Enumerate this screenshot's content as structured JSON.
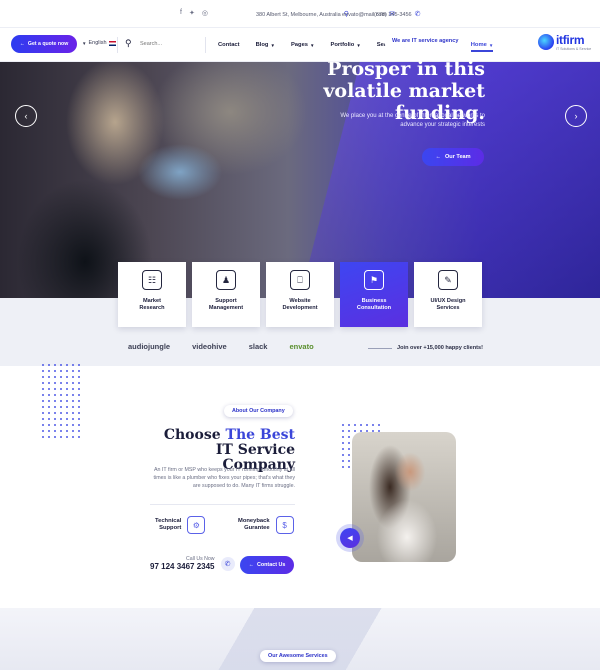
{
  "topbar": {
    "phone": "(678) 345-3456",
    "email": "envato@mail.com",
    "address": "380 Albert St, Melbourne, Australia",
    "social_icons": [
      "facebook-icon",
      "twitter-icon",
      "instagram-icon"
    ]
  },
  "nav": {
    "quote_label": "Get a quote now",
    "language": "English",
    "search_placeholder": "Search...",
    "menu": [
      "Contact",
      "Blog",
      "Pages",
      "Portfolio",
      "Services",
      "About us",
      "Home"
    ],
    "active_menu": "Home",
    "brand": "itfirm",
    "brand_tagline": "IT Solutions & Service"
  },
  "hero": {
    "badge": "We are IT service agency",
    "title": "Prosper in this volatile market funding.",
    "text": "We place you at the centre of international networks to advance your strategic interests",
    "button": "Our Team",
    "prev_icon": "chevron-left-icon",
    "next_icon": "chevron-right-icon"
  },
  "services_cards": [
    {
      "label": "Market\nResearch",
      "icon": "research-icon",
      "active": false
    },
    {
      "label": "Support\nManagement",
      "icon": "support-icon",
      "active": false
    },
    {
      "label": "Website\nDevelopment",
      "icon": "website-icon",
      "active": false
    },
    {
      "label": "Business\nConsultation",
      "icon": "consultation-icon",
      "active": true
    },
    {
      "label": "UI/UX Design\nServices",
      "icon": "design-icon",
      "active": false
    }
  ],
  "partners": {
    "joined_text": "Join over +15,000 happy clients!",
    "logos": [
      "audiojungle",
      "videohive",
      "slack",
      "envato"
    ]
  },
  "about": {
    "badge": "About Our Company",
    "title_pre": "Choose ",
    "title_accent": "The Best",
    "title_post": " IT Service Company",
    "text": "An IT firm or MSP who keeps your IT running smoothly at all times is like a plumber who fixes your pipes; that's what they are supposed to do. Many IT firms struggle.",
    "features": [
      {
        "label": "Technical\nSupport",
        "icon": "technical-support-icon"
      },
      {
        "label": "Moneyback\nGurantee",
        "icon": "moneyback-icon"
      }
    ],
    "button": "Contact Us",
    "call_label": "Call Us Now",
    "call_number": "97 124 3467 2345"
  },
  "bottom": {
    "badge": "Our Awesome Services"
  },
  "colors": {
    "accent": "#3b46d9",
    "gradient_start": "#3b46f0",
    "gradient_end": "#5c2ce6",
    "dark": "#1b1d3a"
  }
}
